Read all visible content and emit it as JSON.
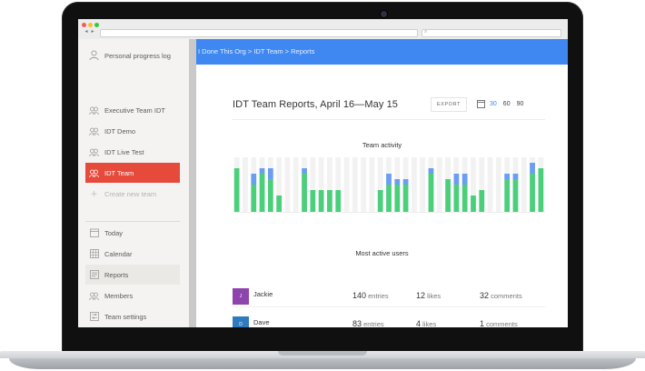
{
  "sidebar": {
    "items": [
      {
        "label": "Personal progress log",
        "icon": "person-icon"
      },
      {
        "label": "Executive Team IDT",
        "icon": "team-icon"
      },
      {
        "label": "IDT Demo",
        "icon": "team-icon"
      },
      {
        "label": "IDT Live Test",
        "icon": "team-icon"
      },
      {
        "label": "IDT Team",
        "icon": "team-icon"
      },
      {
        "label": "Create new team",
        "icon": "plus-icon"
      }
    ],
    "nav": [
      {
        "label": "Today",
        "icon": "today-icon"
      },
      {
        "label": "Calendar",
        "icon": "calendar-icon"
      },
      {
        "label": "Reports",
        "icon": "reports-icon"
      },
      {
        "label": "Members",
        "icon": "members-icon"
      },
      {
        "label": "Team settings",
        "icon": "settings-icon"
      }
    ]
  },
  "header": {
    "breadcrumb": "I Done This Org > IDT Team > Reports",
    "color": "#3f88f2"
  },
  "report": {
    "title": "IDT Team Reports, April 16—May 15",
    "export_label": "EXPORT",
    "ranges": [
      "30",
      "60",
      "90"
    ],
    "selected_range": "30"
  },
  "chart_data": {
    "type": "bar",
    "title": "Team activity",
    "xlabel": "",
    "ylabel": "",
    "grid": false,
    "ylim": [
      0,
      10
    ],
    "series": [
      {
        "values": [
          8,
          0,
          5,
          7,
          6,
          3,
          0,
          0,
          7,
          4,
          4,
          4,
          4,
          0,
          0,
          0,
          0,
          4,
          5,
          5,
          5,
          0,
          0,
          7,
          0,
          6,
          5,
          5,
          3,
          4,
          0,
          0,
          6,
          6,
          0,
          7,
          8
        ]
      },
      {
        "values": [
          0,
          0,
          2,
          1,
          2,
          0,
          0,
          0,
          1,
          0,
          0,
          0,
          0,
          0,
          0,
          0,
          0,
          0,
          2,
          1,
          1,
          0,
          0,
          1,
          0,
          0,
          2,
          2,
          0,
          0,
          0,
          0,
          1,
          1,
          0,
          2,
          0
        ]
      }
    ],
    "colors": {
      "series1": "#4ccf7b",
      "series2": "#6b9df2",
      "track": "#f2f2f2"
    }
  },
  "users": {
    "title": "Most active users",
    "rows": [
      {
        "initial": "J",
        "name": "Jackie",
        "entries": "140",
        "entries_label": "entries",
        "likes": "12",
        "likes_label": "likes",
        "comments": "32",
        "comments_label": "comments",
        "color": "#8e44ad"
      },
      {
        "initial": "D",
        "name": "Dave",
        "entries": "83",
        "entries_label": "entries",
        "likes": "4",
        "likes_label": "likes",
        "comments": "1",
        "comments_label": "comments",
        "color": "#2e7bbf"
      }
    ]
  }
}
